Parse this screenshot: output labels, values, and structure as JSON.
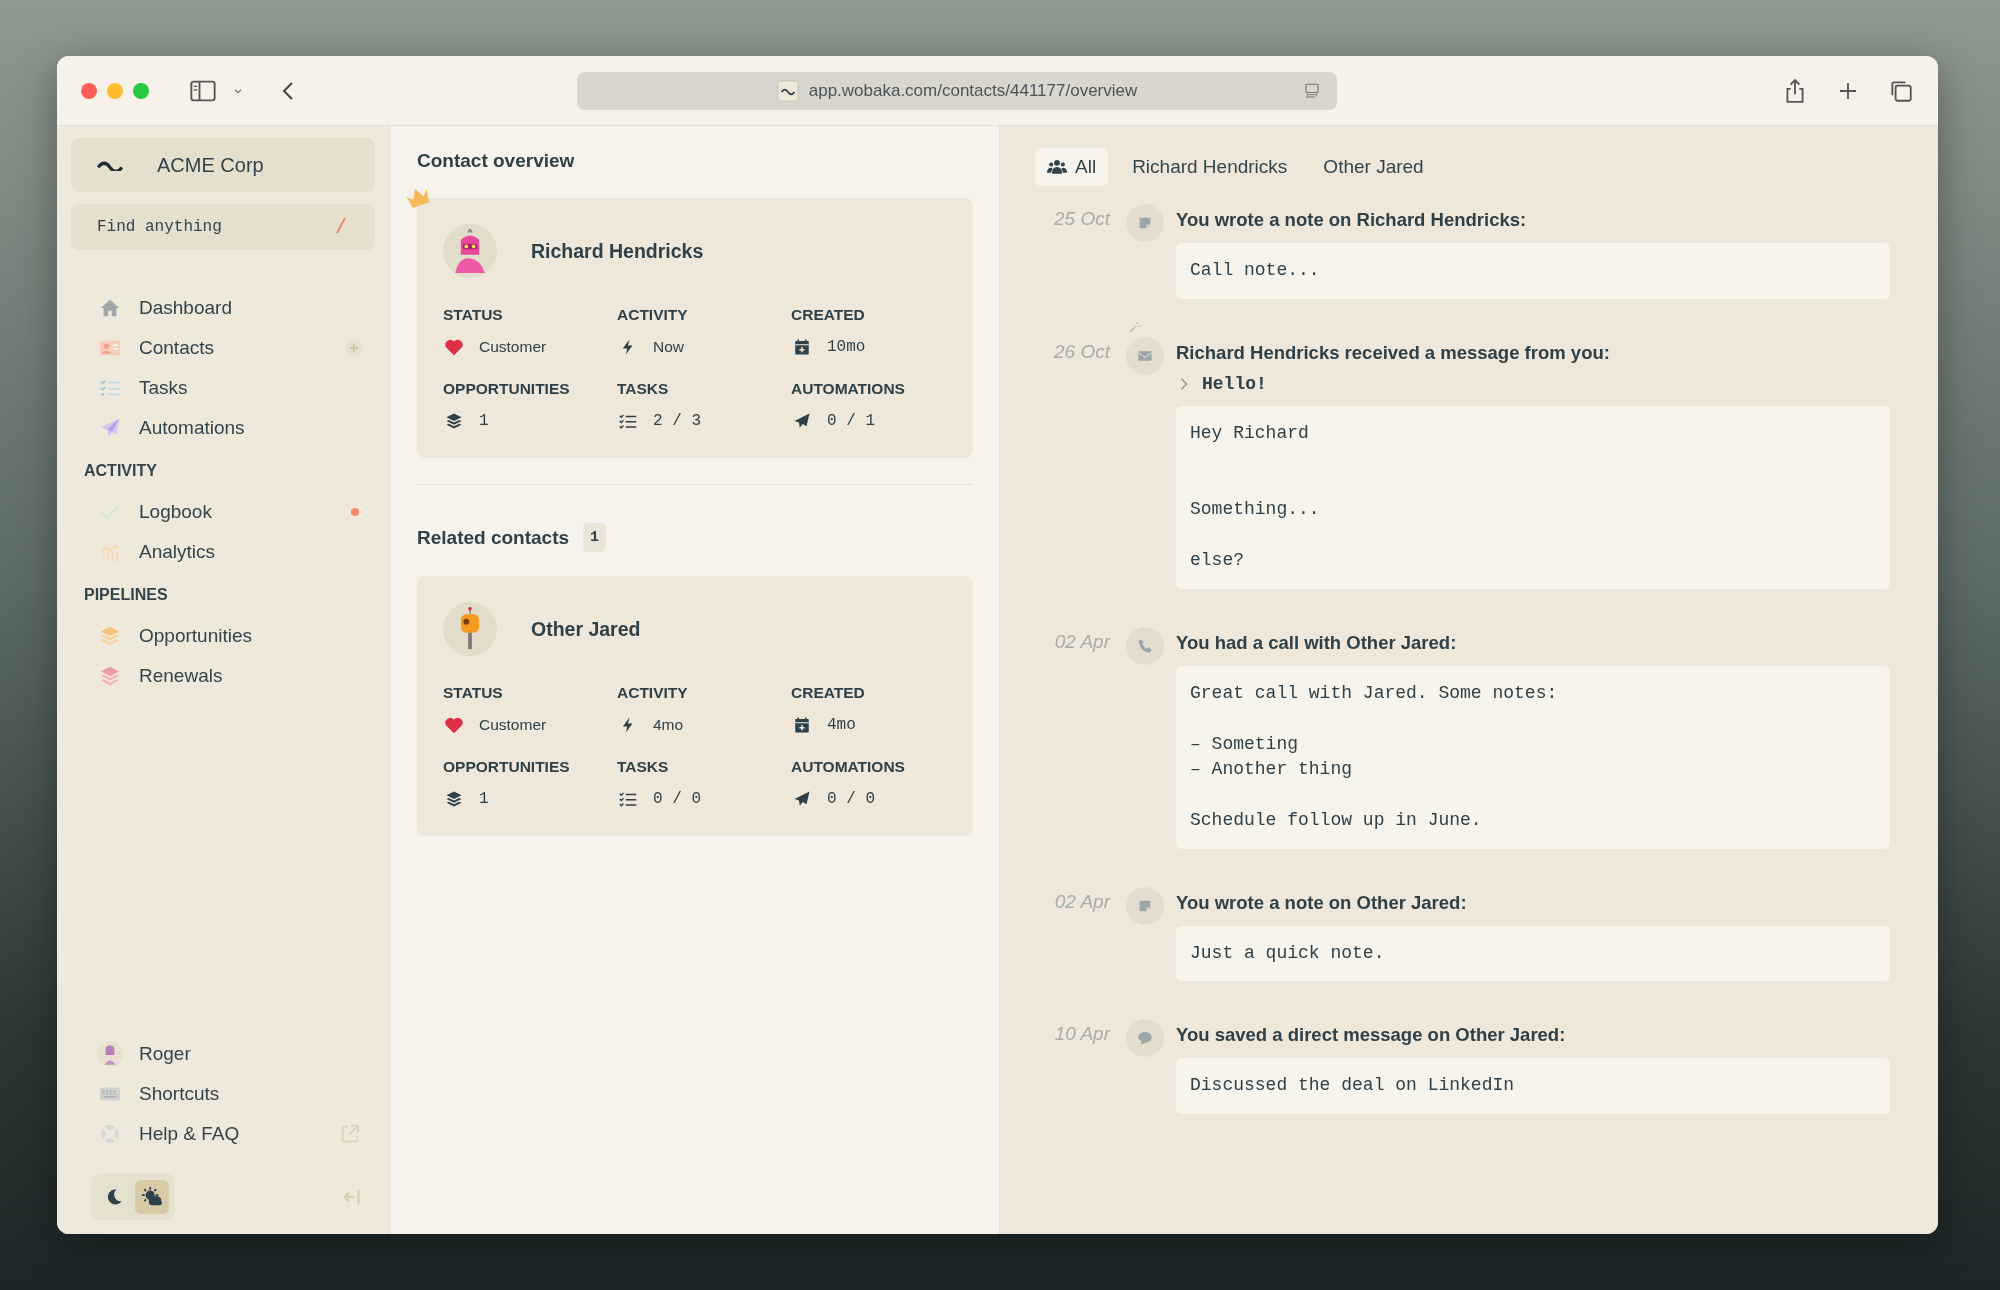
{
  "browser": {
    "url": "app.wobaka.com/contacts/441177/overview"
  },
  "sidebar": {
    "workspace": "ACME Corp",
    "search": {
      "placeholder": "Find anything",
      "shortcut": "/"
    },
    "nav": [
      {
        "label": "Dashboard",
        "kind": "home",
        "can_add": false
      },
      {
        "label": "Contacts",
        "kind": "contacts",
        "can_add": true
      },
      {
        "label": "Tasks",
        "kind": "tasks",
        "can_add": false
      },
      {
        "label": "Automations",
        "kind": "automations",
        "can_add": false
      }
    ],
    "groups": [
      {
        "title": "ACTIVITY",
        "items": [
          {
            "label": "Logbook",
            "kind": "logbook",
            "unread": true
          },
          {
            "label": "Analytics",
            "kind": "analytics",
            "unread": false
          }
        ]
      },
      {
        "title": "PIPELINES",
        "items": [
          {
            "label": "Opportunities",
            "kind": "opportunities"
          },
          {
            "label": "Renewals",
            "kind": "renewals"
          }
        ]
      }
    ],
    "footer": [
      {
        "label": "Roger",
        "kind": "avatar",
        "external": false
      },
      {
        "label": "Shortcuts",
        "kind": "keyboard",
        "external": false
      },
      {
        "label": "Help & FAQ",
        "kind": "help",
        "external": true
      }
    ],
    "theme": [
      {
        "kind": "dark",
        "selected": false
      },
      {
        "kind": "auto",
        "selected": true
      }
    ]
  },
  "main": {
    "title": "Contact overview",
    "contact": {
      "name": "Richard Hendricks",
      "primary": true,
      "stats": [
        {
          "kind": "status",
          "label": "STATUS",
          "value": "Customer"
        },
        {
          "kind": "activity",
          "label": "ACTIVITY",
          "value": "Now"
        },
        {
          "kind": "created",
          "label": "CREATED",
          "value": "10mo"
        },
        {
          "kind": "opportunities",
          "label": "OPPORTUNITIES",
          "value": "1"
        },
        {
          "kind": "tasks",
          "label": "TASKS",
          "value": "2 / 3"
        },
        {
          "kind": "automations",
          "label": "AUTOMATIONS",
          "value": "0 / 1"
        }
      ]
    },
    "related": {
      "title": "Related contacts",
      "count": "1",
      "contacts": [
        {
          "name": "Other Jared",
          "primary": false,
          "stats": [
            {
              "kind": "status",
              "label": "STATUS",
              "value": "Customer"
            },
            {
              "kind": "activity",
              "label": "ACTIVITY",
              "value": "4mo"
            },
            {
              "kind": "created",
              "label": "CREATED",
              "value": "4mo"
            },
            {
              "kind": "opportunities",
              "label": "OPPORTUNITIES",
              "value": "1"
            },
            {
              "kind": "tasks",
              "label": "TASKS",
              "value": "0 / 0"
            },
            {
              "kind": "automations",
              "label": "AUTOMATIONS",
              "value": "0 / 0"
            }
          ]
        }
      ]
    }
  },
  "activity": {
    "tabs": [
      {
        "label": "All",
        "selected": true
      },
      {
        "label": "Richard Hendricks",
        "selected": false
      },
      {
        "label": "Other Jared",
        "selected": false
      }
    ],
    "entries": [
      {
        "date": "25 Oct",
        "kind": "note",
        "automated": false,
        "title": "You wrote a note on Richard Hendricks:",
        "body": "Call note..."
      },
      {
        "date": "26 Oct",
        "kind": "email",
        "automated": true,
        "title": "Richard Hendricks received a message from you:",
        "subject": "Hello!",
        "expanded": false,
        "body": "Hey Richard\n\n\nSomething...\n\nelse?"
      },
      {
        "date": "02 Apr",
        "kind": "call",
        "automated": false,
        "title": "You had a call with Other Jared:",
        "body": "Great call with Jared. Some notes:\n\n– Someting\n– Another thing\n\nSchedule follow up in June."
      },
      {
        "date": "02 Apr",
        "kind": "note",
        "automated": false,
        "title": "You wrote a note on Other Jared:",
        "body": "Just a quick note."
      },
      {
        "date": "10 Apr",
        "kind": "message",
        "automated": false,
        "title": "You saved a direct message on Other Jared:",
        "body": "Discussed the deal on LinkedIn"
      }
    ]
  }
}
